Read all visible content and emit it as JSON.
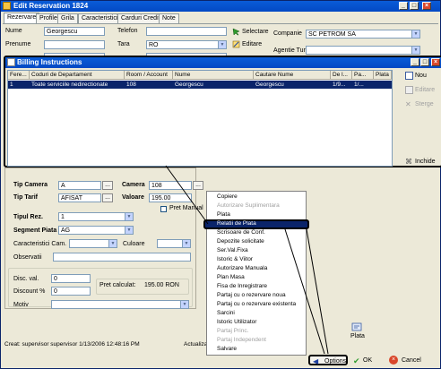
{
  "window": {
    "title": "Edit Reservation 1824"
  },
  "tabs": [
    "Rezervare",
    "Profile",
    "Grila",
    "Caracteristici",
    "Carduri Credit",
    "Note"
  ],
  "top_form": {
    "nume_label": "Nume",
    "nume_value": "Georgescu",
    "prenume_label": "Prenume",
    "telefon_label": "Telefon",
    "tara_label": "Tara",
    "tara_value": "RO",
    "selectare_label": "Selectare",
    "editare_label": "Editare",
    "compania_label": "Companie",
    "compania_value": "SC PETROM SA",
    "agentie_label": "Agentie Turism"
  },
  "billing": {
    "title": "Billing Instructions",
    "columns": [
      "Fere...",
      "Coduri de Departament",
      "Room / Account",
      "Nume",
      "Cautare Nume",
      "De l...",
      "Pa...",
      "Plata"
    ],
    "row": [
      "1",
      "Toate serviciile nedirectionate",
      "108",
      "Georgescu",
      "Georgescu",
      "1/9...",
      "1/..."
    ],
    "btn_nou": "Nou",
    "btn_editare": "Editare",
    "btn_sterge": "Sterge",
    "btn_inchide": "Inchide"
  },
  "lower_form": {
    "tip_camera_label": "Tip Camera",
    "tip_camera_value": "A",
    "camera_label": "Camera",
    "camera_value": "108",
    "tip_tarif_label": "Tip Tarif",
    "tip_tarif_value": "AFISAT",
    "valoare_label": "Valoare",
    "valoare_value": "195.00",
    "pret_manual_label": "Pret Manual",
    "tipul_rez_label": "Tipul Rez.",
    "tipul_rez_value": "1",
    "segment_label": "Segment Piata",
    "segment_value": "AG",
    "caracteristici_label": "Caracteristici Cam.",
    "culoare_label": "Culoare",
    "observatii_label": "Observatii",
    "disc_val_label": "Disc. val.",
    "disc_val_value": "0",
    "discount_label": "Discount %",
    "discount_value": "0",
    "pret_calc_label": "Pret calculat:",
    "pret_calc_value": "195.00 RON",
    "motiv_label": "Motiv"
  },
  "context_menu": {
    "items": [
      {
        "label": "Copiere",
        "disabled": false
      },
      {
        "label": "Autorizare Suplimentara",
        "disabled": true
      },
      {
        "label": "Plata",
        "disabled": false
      },
      {
        "label": "Relatii de Plata",
        "disabled": false,
        "selected": true
      },
      {
        "label": "Scrisoare de Conf.",
        "disabled": false
      },
      {
        "label": "Depozite solicitate",
        "disabled": false
      },
      {
        "label": "Ser.Val.Fixa",
        "disabled": false
      },
      {
        "label": "Istoric & Viitor",
        "disabled": false
      },
      {
        "label": "Autorizare Manuala",
        "disabled": false
      },
      {
        "label": "Plan Masa",
        "disabled": false
      },
      {
        "label": "Fisa de Inregistrare",
        "disabled": false
      },
      {
        "label": "Partaj cu o rezervare noua",
        "disabled": false
      },
      {
        "label": "Partaj cu o rezervare existenta",
        "disabled": false
      },
      {
        "label": "Sarcini",
        "disabled": false
      },
      {
        "label": "Istoric Utilizator",
        "disabled": false
      },
      {
        "label": "Partaj Princ.",
        "disabled": true
      },
      {
        "label": "Partaj Independent",
        "disabled": true
      },
      {
        "label": "Salvare",
        "disabled": false
      }
    ]
  },
  "plata_icon_label": "Plata",
  "status": {
    "created": "Creat: supervisor supervisor 1/13/2006 12:48:16 PM",
    "updated": "Actualizat: supervisor sup"
  },
  "footer": {
    "options": "Options",
    "ok": "OK",
    "cancel": "Cancel"
  },
  "colors": {
    "titlebar": "#0349c4",
    "selection": "#0a246a",
    "window_bg": "#ece9d8"
  }
}
